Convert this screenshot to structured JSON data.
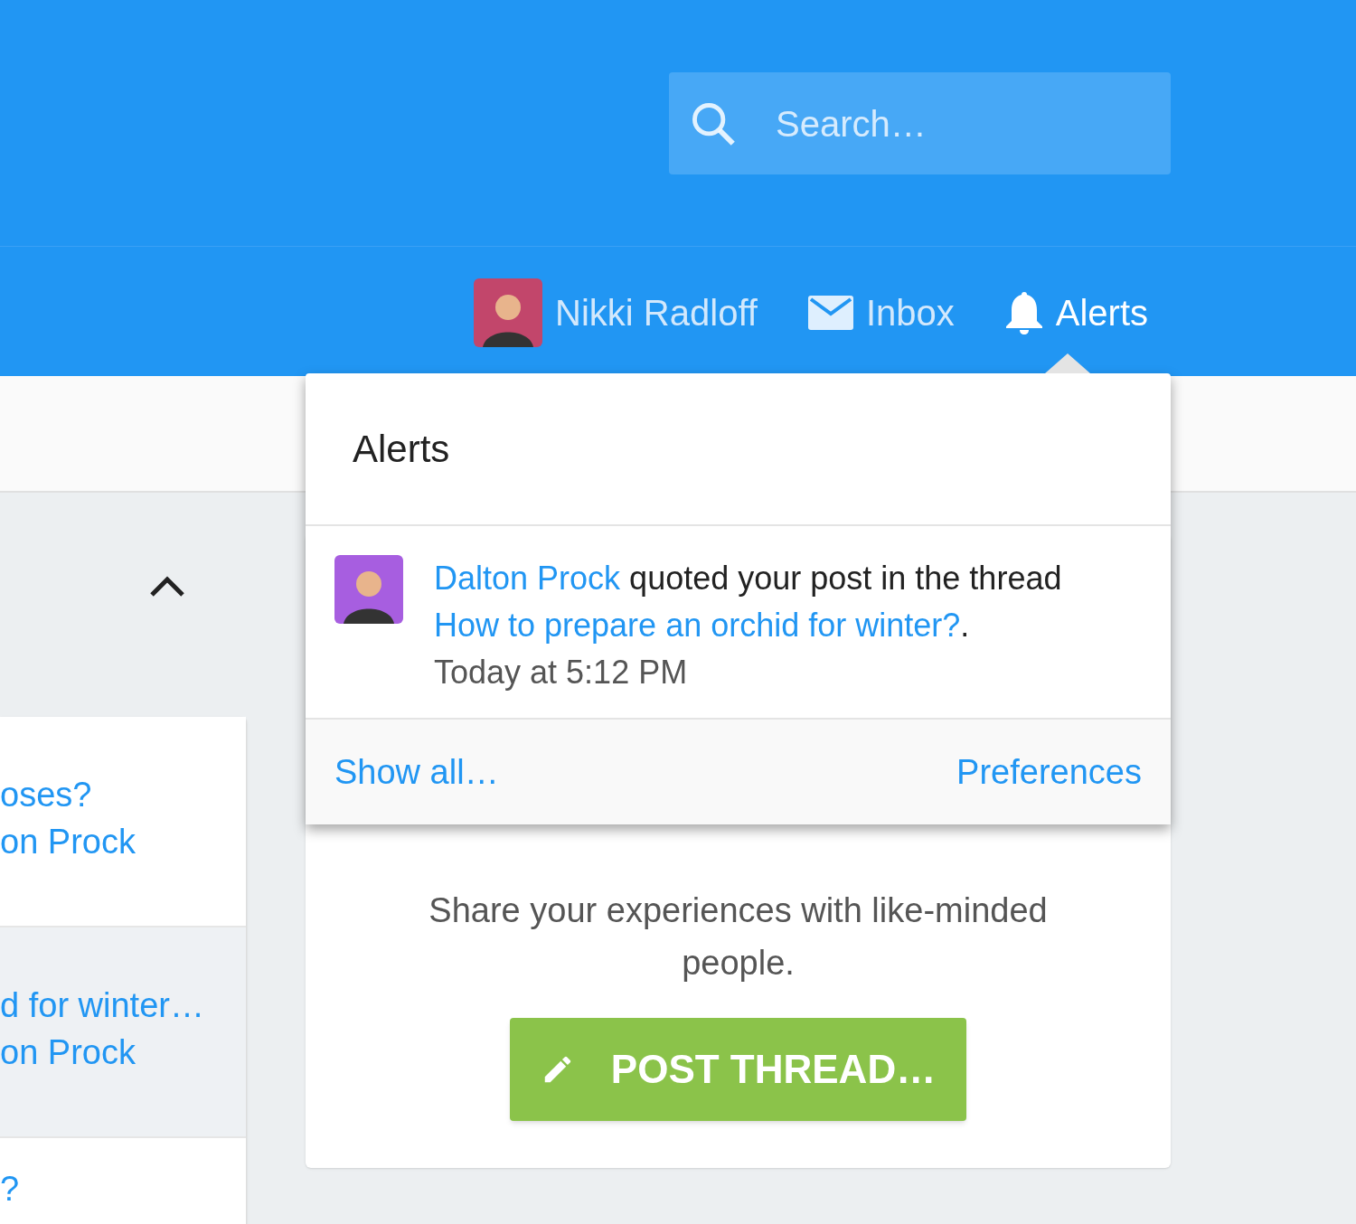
{
  "header": {
    "search": {
      "placeholder": "Search…"
    }
  },
  "nav": [
    {
      "label": "Nikki Radloff",
      "kind": "user",
      "selected": false
    },
    {
      "label": "Inbox",
      "kind": "inbox",
      "selected": false
    },
    {
      "label": "Alerts",
      "kind": "alerts",
      "selected": true
    }
  ],
  "alerts_menu": {
    "title": "Alerts",
    "items": [
      {
        "user": "Dalton Prock",
        "text": "quoted your post in the thread",
        "thread": "How to prepare an orchid for winter?",
        "end": ".",
        "time": "Today at 5:12 PM"
      }
    ],
    "footer": {
      "show_all": "Show all…",
      "preferences": "Preferences"
    }
  },
  "sidebar": {
    "threads": [
      {
        "title": "oses?",
        "author": "on Prock",
        "selected": false
      },
      {
        "title": "d for winter…",
        "author": "on Prock",
        "selected": true
      },
      {
        "title": "?",
        "selected": false
      }
    ]
  },
  "cta": {
    "text": "Share your experiences with like-minded people.",
    "button": "POST THREAD…"
  }
}
